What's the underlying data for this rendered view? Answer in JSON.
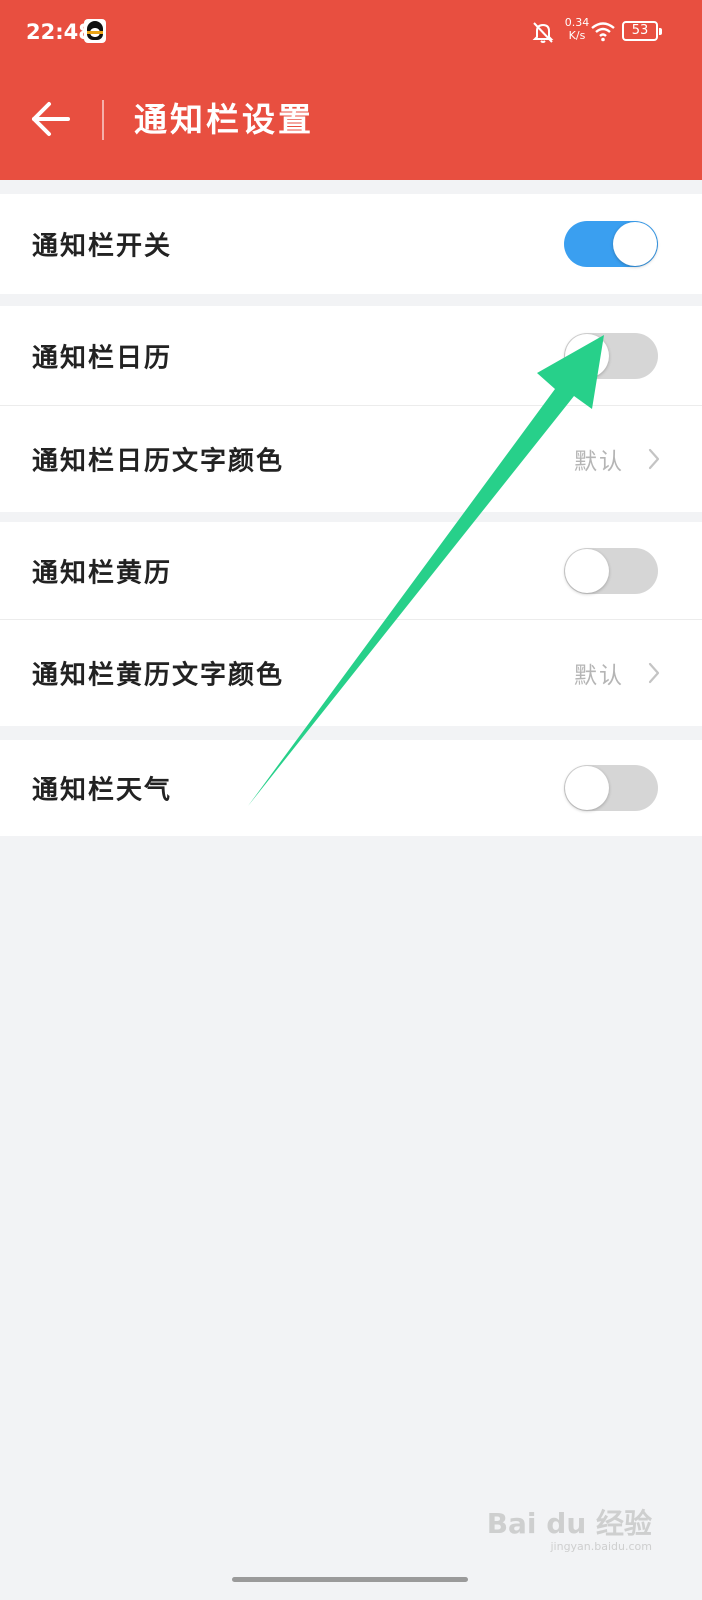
{
  "status_bar": {
    "time": "22:48",
    "speed_value": "0.34",
    "speed_unit": "K/s",
    "battery": "53",
    "icons": [
      "qq-icon",
      "bell-off-icon",
      "wifi-icon",
      "battery-icon"
    ]
  },
  "header": {
    "title": "通知栏设置",
    "back_icon": "arrow-left-icon",
    "color": "#e84f40"
  },
  "groups": [
    {
      "rows": [
        {
          "label": "通知栏开关",
          "type": "toggle",
          "on": true
        }
      ]
    },
    {
      "rows": [
        {
          "label": "通知栏日历",
          "type": "toggle",
          "on": false
        },
        {
          "label": "通知栏日历文字颜色",
          "type": "link",
          "value": "默认"
        }
      ]
    },
    {
      "rows": [
        {
          "label": "通知栏黄历",
          "type": "toggle",
          "on": false
        },
        {
          "label": "通知栏黄历文字颜色",
          "type": "link",
          "value": "默认"
        }
      ]
    },
    {
      "rows": [
        {
          "label": "通知栏天气",
          "type": "toggle",
          "on": false
        }
      ]
    }
  ],
  "colors": {
    "toggle_on": "#3a9ff0",
    "toggle_off": "#d6d6d6",
    "annotation_arrow": "#27d08a"
  },
  "watermark": {
    "brand": "Bai du 经验",
    "url": "jingyan.baidu.com"
  }
}
